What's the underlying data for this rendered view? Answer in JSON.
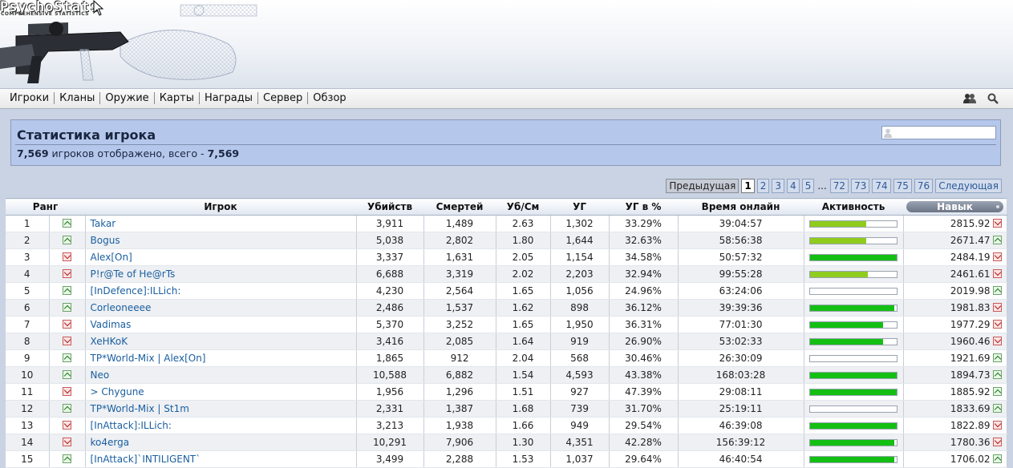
{
  "app": {
    "logo_text": "PsychoStats",
    "logo_subtitle": "COMPREHENSIVE STATISTICS"
  },
  "nav": {
    "items": [
      "Игроки",
      "Кланы",
      "Оружие",
      "Карты",
      "Награды",
      "Сервер",
      "Обзор"
    ],
    "icons": [
      "users-icon",
      "search-icon"
    ]
  },
  "panel": {
    "title": "Статистика игрока",
    "shown_count": "7,569",
    "shown_text": "игроков отображено, всего -",
    "total_count": "7,569",
    "search_placeholder": ""
  },
  "pager": {
    "prev": "Предыдущая",
    "pages": [
      "1",
      "2",
      "3",
      "4",
      "5"
    ],
    "ellipsis": "...",
    "tail_pages": [
      "72",
      "73",
      "74",
      "75",
      "76"
    ],
    "next": "Следующая",
    "current": "1"
  },
  "table": {
    "headers": [
      "Ранг",
      "Игрок",
      "Убийств",
      "Смертей",
      "Уб/См",
      "УГ",
      "УГ в %",
      "Время онлайн",
      "Активность",
      "Навык"
    ],
    "activity_color_high": "#14bf14",
    "activity_color_mid": "#8fcc1e",
    "rows": [
      {
        "rank": "1",
        "trend": "up",
        "player": "Takar",
        "kills": "3,911",
        "deaths": "1,489",
        "kd": "2.63",
        "hs": "1,302",
        "hsp": "33.29%",
        "time": "39:04:57",
        "activity": 0.65,
        "skill": "2815.92",
        "skill_trend": "down"
      },
      {
        "rank": "2",
        "trend": "up",
        "player": "Bogus",
        "kills": "5,038",
        "deaths": "2,802",
        "kd": "1.80",
        "hs": "1,644",
        "hsp": "32.63%",
        "time": "58:56:38",
        "activity": 0.65,
        "skill": "2671.47",
        "skill_trend": "up"
      },
      {
        "rank": "3",
        "trend": "down",
        "player": "Alex[On]",
        "kills": "3,337",
        "deaths": "1,631",
        "kd": "2.05",
        "hs": "1,154",
        "hsp": "34.58%",
        "time": "50:57:32",
        "activity": 1.0,
        "skill": "2484.19",
        "skill_trend": "down"
      },
      {
        "rank": "4",
        "trend": "down",
        "player": "P!r@Te of He@rTs",
        "kills": "6,688",
        "deaths": "3,319",
        "kd": "2.02",
        "hs": "2,203",
        "hsp": "32.94%",
        "time": "99:55:28",
        "activity": 0.67,
        "skill": "2461.61",
        "skill_trend": "down"
      },
      {
        "rank": "5",
        "trend": "up",
        "player": "[InDefence]:ILLich:",
        "kills": "4,230",
        "deaths": "2,564",
        "kd": "1.65",
        "hs": "1,056",
        "hsp": "24.96%",
        "time": "63:24:06",
        "activity": 0,
        "skill": "2019.98",
        "skill_trend": "up"
      },
      {
        "rank": "6",
        "trend": "up",
        "player": "Corleoneeee",
        "kills": "2,486",
        "deaths": "1,537",
        "kd": "1.62",
        "hs": "898",
        "hsp": "36.12%",
        "time": "39:39:36",
        "activity": 0.97,
        "skill": "1981.83",
        "skill_trend": "down"
      },
      {
        "rank": "7",
        "trend": "down",
        "player": "Vadimas",
        "kills": "5,370",
        "deaths": "3,252",
        "kd": "1.65",
        "hs": "1,950",
        "hsp": "36.31%",
        "time": "77:01:30",
        "activity": 0.84,
        "skill": "1977.29",
        "skill_trend": "down"
      },
      {
        "rank": "8",
        "trend": "down",
        "player": "XeHKoK",
        "kills": "3,416",
        "deaths": "2,085",
        "kd": "1.64",
        "hs": "919",
        "hsp": "26.90%",
        "time": "53:02:33",
        "activity": 0.84,
        "skill": "1960.46",
        "skill_trend": "down"
      },
      {
        "rank": "9",
        "trend": "up",
        "player": "TP*World-Mix | Alex[On]",
        "kills": "1,865",
        "deaths": "912",
        "kd": "2.04",
        "hs": "568",
        "hsp": "30.46%",
        "time": "26:30:09",
        "activity": 0,
        "skill": "1921.69",
        "skill_trend": "up"
      },
      {
        "rank": "10",
        "trend": "up",
        "player": "Neo",
        "kills": "10,588",
        "deaths": "6,882",
        "kd": "1.54",
        "hs": "4,593",
        "hsp": "43.38%",
        "time": "168:03:28",
        "activity": 1.0,
        "skill": "1894.73",
        "skill_trend": "up"
      },
      {
        "rank": "11",
        "trend": "down",
        "player": "> Chygune",
        "kills": "1,956",
        "deaths": "1,296",
        "kd": "1.51",
        "hs": "927",
        "hsp": "47.39%",
        "time": "29:08:11",
        "activity": 1.0,
        "skill": "1885.92",
        "skill_trend": "up"
      },
      {
        "rank": "12",
        "trend": "up",
        "player": "TP*World-Mix | St1m",
        "kills": "2,331",
        "deaths": "1,387",
        "kd": "1.68",
        "hs": "739",
        "hsp": "31.70%",
        "time": "25:19:11",
        "activity": 0,
        "skill": "1833.69",
        "skill_trend": "up"
      },
      {
        "rank": "13",
        "trend": "down",
        "player": "[InAttack]:ILLich:",
        "kills": "3,213",
        "deaths": "1,938",
        "kd": "1.66",
        "hs": "949",
        "hsp": "29.54%",
        "time": "46:39:08",
        "activity": 1.0,
        "skill": "1822.89",
        "skill_trend": "down"
      },
      {
        "rank": "14",
        "trend": "down",
        "player": "ko4erga",
        "kills": "10,291",
        "deaths": "7,906",
        "kd": "1.30",
        "hs": "4,351",
        "hsp": "42.28%",
        "time": "156:39:12",
        "activity": 0.97,
        "skill": "1780.36",
        "skill_trend": "down"
      },
      {
        "rank": "15",
        "trend": "up",
        "player": "[InAttack]`INTILIGENT`",
        "kills": "3,499",
        "deaths": "2,288",
        "kd": "1.53",
        "hs": "1,037",
        "hsp": "29.64%",
        "time": "46:40:54",
        "activity": 0.97,
        "skill": "1706.02",
        "skill_trend": "up"
      }
    ]
  }
}
